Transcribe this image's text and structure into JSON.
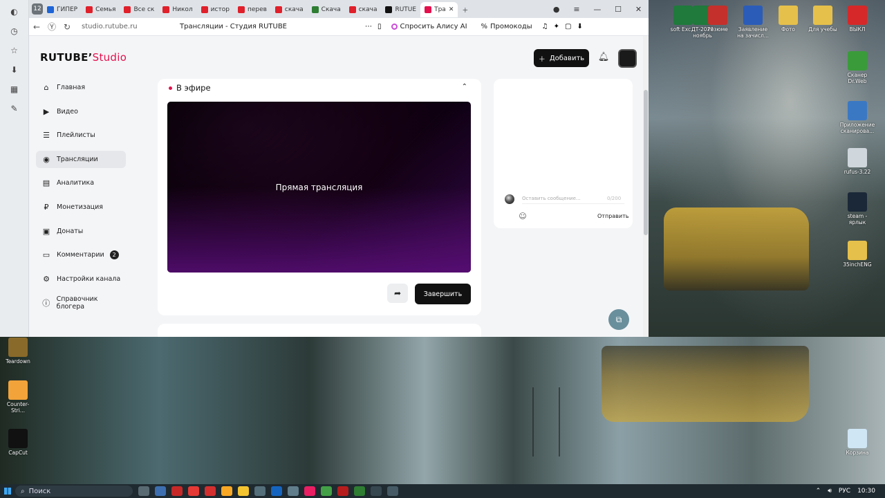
{
  "browser": {
    "tab_count": "12",
    "tabs": [
      {
        "label": "ГИПЕР",
        "color": "#1e64d6"
      },
      {
        "label": "Семья",
        "color": "#e0202a"
      },
      {
        "label": "Все ск",
        "color": "#e0202a"
      },
      {
        "label": "Никол",
        "color": "#e0202a"
      },
      {
        "label": "истор",
        "color": "#e0202a"
      },
      {
        "label": "перев",
        "color": "#e0202a"
      },
      {
        "label": "скача",
        "color": "#e0202a"
      },
      {
        "label": "Скача",
        "color": "#2e7d32"
      },
      {
        "label": "скача",
        "color": "#e0202a"
      },
      {
        "label": "RUTUE",
        "color": "#111111"
      },
      {
        "label": "Тра",
        "color": "#e3104d"
      }
    ],
    "url": "studio.rutube.ru",
    "page_title": "Трансляции - Студия RUTUBE",
    "alice_label": "Спросить Алису AI",
    "promo_label": "Промокоды"
  },
  "app": {
    "logo_main": "RUTUBE",
    "logo_sub": "Studio",
    "add_button": "Добавить",
    "nav": [
      {
        "label": "Главная",
        "icon": "home-icon",
        "glyph": "⌂"
      },
      {
        "label": "Видео",
        "icon": "video-icon",
        "glyph": "▶"
      },
      {
        "label": "Плейлисты",
        "icon": "playlist-icon",
        "glyph": "☰"
      },
      {
        "label": "Трансляции",
        "icon": "broadcast-icon",
        "glyph": "◉"
      },
      {
        "label": "Аналитика",
        "icon": "analytics-icon",
        "glyph": "▤"
      },
      {
        "label": "Монетизация",
        "icon": "monetization-icon",
        "glyph": "₽"
      },
      {
        "label": "Донаты",
        "icon": "donate-icon",
        "glyph": "▣"
      },
      {
        "label": "Комментарии",
        "icon": "comments-icon",
        "glyph": "▭",
        "badge": "2"
      },
      {
        "label": "Настройки канала",
        "icon": "settings-icon",
        "glyph": "⚙"
      },
      {
        "label": "Справочник блогера",
        "icon": "info-icon",
        "glyph": "ⓘ"
      }
    ],
    "live_header": "В эфире",
    "player_label": "Прямая трансляция",
    "end_button": "Завершить",
    "chat": {
      "placeholder": "Оставить сообщение...",
      "counter": "0/200",
      "send_label": "Отправить"
    }
  },
  "desktop_icons": [
    {
      "label": "soft Exc...",
      "color": "#1f7a3b"
    },
    {
      "label": "ДТ-2023 ноябрь",
      "color": "#1f7a3b"
    },
    {
      "label": "Резюме",
      "color": "#c4302b"
    },
    {
      "label": "Заявление на зачисл...",
      "color": "#2b5cb8"
    },
    {
      "label": "Фото",
      "color": "#e5c04a"
    },
    {
      "label": "Для учебы",
      "color": "#e5c04a"
    },
    {
      "label": "ВЫКЛ",
      "color": "#d62828"
    },
    {
      "label": "Сканер Dr.Web",
      "color": "#3a9b3a"
    },
    {
      "label": "Приложение сканирова...",
      "color": "#3b78c4"
    },
    {
      "label": "rufus-3.22",
      "color": "#cfd6dc"
    },
    {
      "label": "steam - ярлык",
      "color": "#1b2838"
    },
    {
      "label": "35inchENG",
      "color": "#e5c04a"
    },
    {
      "label": "Teardown",
      "color": "#8a6a2a"
    },
    {
      "label": "Counter-Stri...",
      "color": "#f2a33a"
    },
    {
      "label": "CapCut",
      "color": "#111111"
    },
    {
      "label": "Корзина",
      "color": "#cfe6f5"
    }
  ],
  "taskbar": {
    "search_label": "Поиск",
    "lang": "РУС",
    "time": "10:30"
  }
}
